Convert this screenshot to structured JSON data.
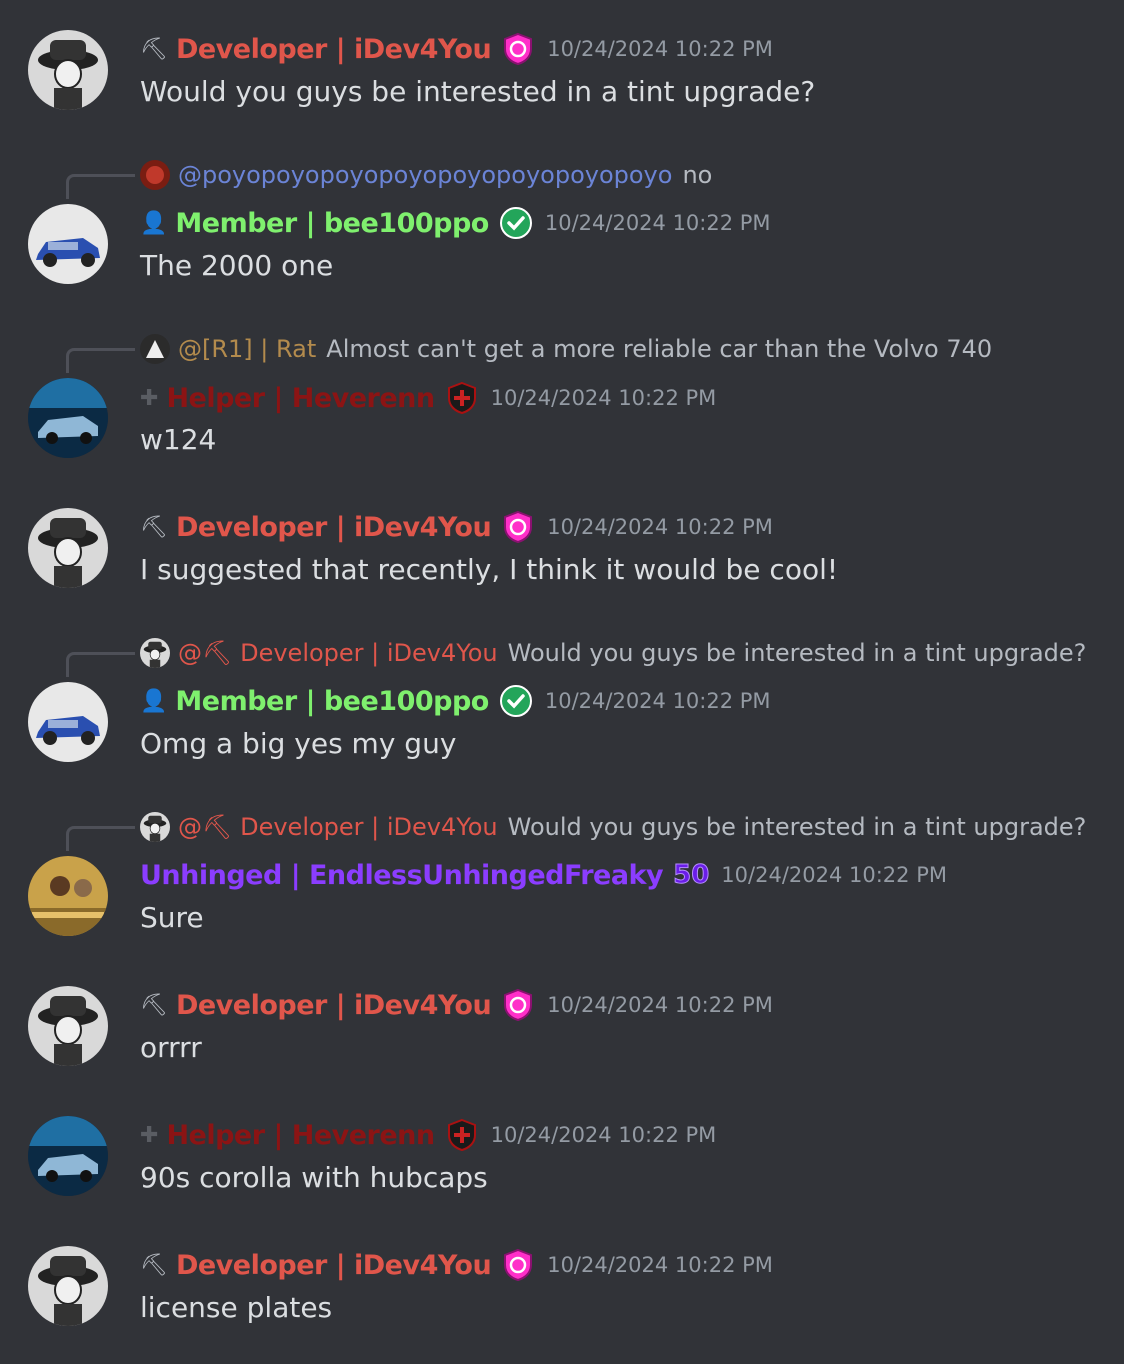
{
  "messages": [
    {
      "author": "Developer | iDev4You",
      "role_icon": "hammer-icon",
      "timestamp": "10/24/2024 10:22 PM",
      "text": "Would you guys be interested in a tint upgrade?"
    },
    {
      "reply": {
        "name": "@poyopoyopoyopoyopoyopoyopoyopoyo",
        "text": "no"
      },
      "author": "Member | bee100ppo",
      "role_icon": "person-icon",
      "timestamp": "10/24/2024 10:22 PM",
      "text": "The 2000 one"
    },
    {
      "reply": {
        "name": "@[R1] | Rat",
        "text": "Almost can't get a more reliable car than the Volvo 740"
      },
      "author": "Helper | Heverenn",
      "role_icon": "plus-icon",
      "timestamp": "10/24/2024 10:22 PM",
      "text": "w124"
    },
    {
      "author": "Developer | iDev4You",
      "role_icon": "hammer-icon",
      "timestamp": "10/24/2024 10:22 PM",
      "text": "I suggested that recently, I think it would be cool!"
    },
    {
      "reply": {
        "name": "@⛏ Developer | iDev4You",
        "text": "Would you guys be interested in a tint upgrade?"
      },
      "author": "Member | bee100ppo",
      "role_icon": "person-icon",
      "timestamp": "10/24/2024 10:22 PM",
      "text": "Omg a big yes my guy"
    },
    {
      "reply": {
        "name": "@⛏ Developer | iDev4You",
        "text": "Would you guys be interested in a tint upgrade?"
      },
      "author": "Unhinged | EndlessUnhingedFreaky",
      "badge_text": "50",
      "timestamp": "10/24/2024 10:22 PM",
      "text": "Sure"
    },
    {
      "author": "Developer | iDev4You",
      "role_icon": "hammer-icon",
      "timestamp": "10/24/2024 10:22 PM",
      "text": "orrrr"
    },
    {
      "author": "Helper | Heverenn",
      "role_icon": "plus-icon",
      "timestamp": "10/24/2024 10:22 PM",
      "text": "90s corolla with hubcaps"
    },
    {
      "author": "Developer | iDev4You",
      "role_icon": "hammer-icon",
      "timestamp": "10/24/2024 10:22 PM",
      "text": "license plates"
    }
  ],
  "colors": {
    "background": "#313338",
    "developer": "#e0564b",
    "member": "#7ff06e",
    "helper": "#8b1414",
    "unhinged": "#8b3dff",
    "mention": "#6b84d6"
  }
}
